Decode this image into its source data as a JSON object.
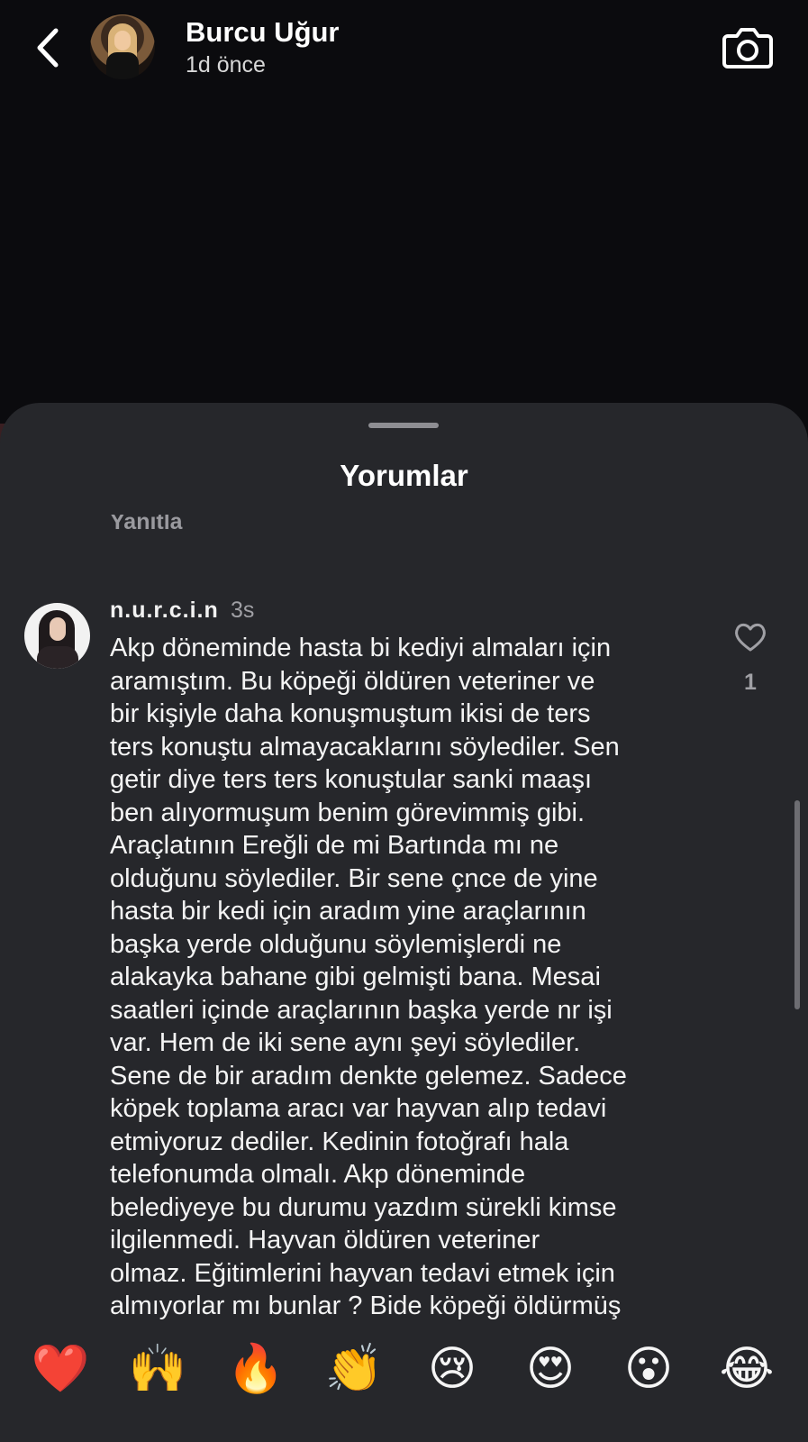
{
  "story": {
    "user_name": "Burcu Uğur",
    "time": "1d önce",
    "icons": [
      "back-icon",
      "camera-icon"
    ]
  },
  "sheet": {
    "title": "Yorumlar",
    "prev_reply_label": "Yanıtla"
  },
  "comment": {
    "user": "n.u.r.c.i.n",
    "time": "3s",
    "text": "Akp döneminde hasta bi kediyi almaları için\naramıştım. Bu köpeği öldüren veteriner ve\nbir kişiyle daha konuşmuştum ikisi de ters\nters konuştu almayacaklarını söylediler. Sen\ngetir diye ters ters konuştular sanki maaşı\nben alıyormuşum benim görevimmiş gibi.\nAraçlatının Ereğli de mi Bartında mı ne\nolduğunu söylediler. Bir sene çnce de yine\nhasta bir kedi için aradım yine araçlarının\nbaşka yerde olduğunu söylemişlerdi ne\nalakayka bahane gibi gelmişti bana. Mesai\nsaatleri içinde araçlarının başka yerde nr işi\nvar. Hem de iki sene aynı şeyi söylediler.\nSene de bir aradım denkte gelemez. Sadece\nköpek toplama aracı var hayvan alıp tedavi\netmiyoruz dediler. Kedinin fotoğrafı hala\ntelefonumda olmalı. Akp döneminde\nbelediyeye bu durumu yazdım sürekli kimse\nilgilenmedi. Hayvan öldüren veteriner\nolmaz. Eğitimlerini hayvan tedavi etmek için\nalmıyorlar mı bunlar ? Bide köpeği öldürmüş",
    "like_count": "1"
  },
  "reactions": [
    {
      "name": "red-heart",
      "glyph": "❤️"
    },
    {
      "name": "raising-hands",
      "glyph": "🙌"
    },
    {
      "name": "fire",
      "glyph": "🔥"
    },
    {
      "name": "clapping-hands",
      "glyph": "👏"
    },
    {
      "name": "crying-face",
      "glyph": "😢"
    },
    {
      "name": "heart-eyes",
      "glyph": "😍"
    },
    {
      "name": "surprised-face",
      "glyph": "😮"
    },
    {
      "name": "tears-of-joy",
      "glyph": "😂"
    }
  ],
  "colors": {
    "background": "#0b0b0e",
    "sheet": "#26272b",
    "secondary_text": "#a0a0a5"
  }
}
